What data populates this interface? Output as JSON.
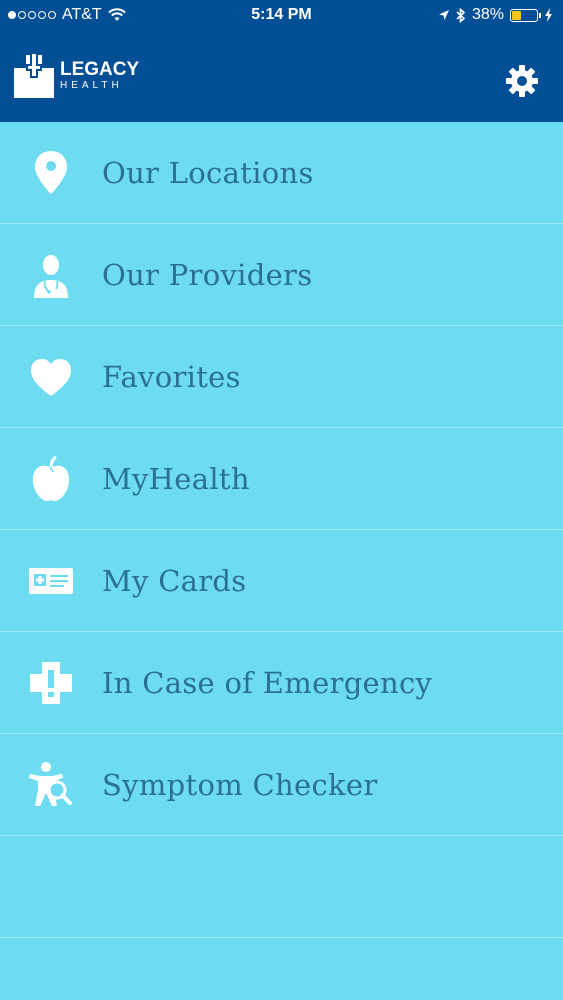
{
  "status_bar": {
    "carrier": "AT&T",
    "time": "5:14 PM",
    "battery": "38%",
    "battery_level": 0.38,
    "signal_bars": 1
  },
  "header": {
    "logo_line1": "LEGACY",
    "logo_line2": "HEALTH",
    "settings_icon": "gear-icon"
  },
  "menu": {
    "items": [
      {
        "label": "Our Locations",
        "icon": "location-pin-icon"
      },
      {
        "label": "Our Providers",
        "icon": "doctor-icon"
      },
      {
        "label": "Favorites",
        "icon": "heart-icon"
      },
      {
        "label": "MyHealth",
        "icon": "apple-icon"
      },
      {
        "label": "My Cards",
        "icon": "card-icon"
      },
      {
        "label": "In Case of Emergency",
        "icon": "emergency-cross-icon"
      },
      {
        "label": "Symptom Checker",
        "icon": "symptom-checker-icon"
      }
    ]
  },
  "colors": {
    "header_bg": "#034f95",
    "menu_bg": "#6ddcf0",
    "label_text": "#2a6f95",
    "separator": "#9de8f6",
    "battery_fill": "#f5c518"
  }
}
